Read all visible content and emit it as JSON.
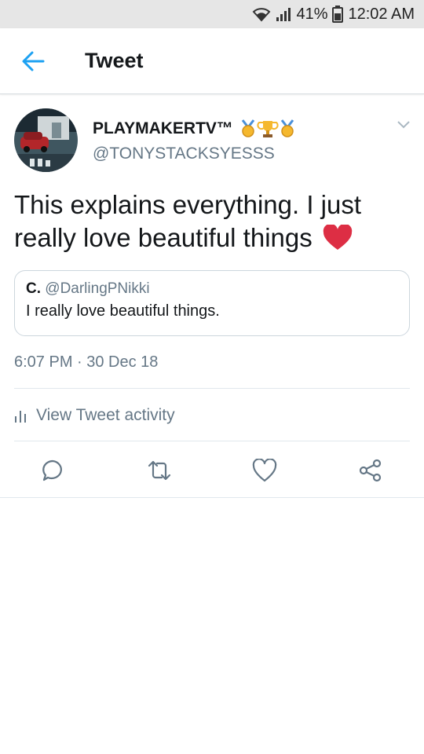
{
  "status_bar": {
    "battery": "41%",
    "time": "12:02 AM"
  },
  "app_bar": {
    "title": "Tweet"
  },
  "tweet": {
    "author": {
      "name": "PLAYMAKERTV™",
      "handle": "@TONYSTACKSYESSS"
    },
    "text": "This explains everything. I just really love beautiful things",
    "quoted": {
      "name": "C.",
      "handle": "@DarlingPNikki",
      "text": "I really love beautiful things."
    },
    "timestamp": "6:07 PM · 30 Dec 18",
    "activity_label": "View Tweet activity"
  },
  "colors": {
    "accent": "#1da1f2",
    "secondary_text": "#657786",
    "heart": "#e0245e"
  },
  "icons": [
    "wifi-icon",
    "signal-icon",
    "battery-icon",
    "back-arrow-icon",
    "chevron-down-icon",
    "medal-icon",
    "trophy-icon",
    "heart-emoji-icon",
    "bar-chart-icon",
    "reply-icon",
    "retweet-icon",
    "like-icon",
    "share-icon"
  ]
}
